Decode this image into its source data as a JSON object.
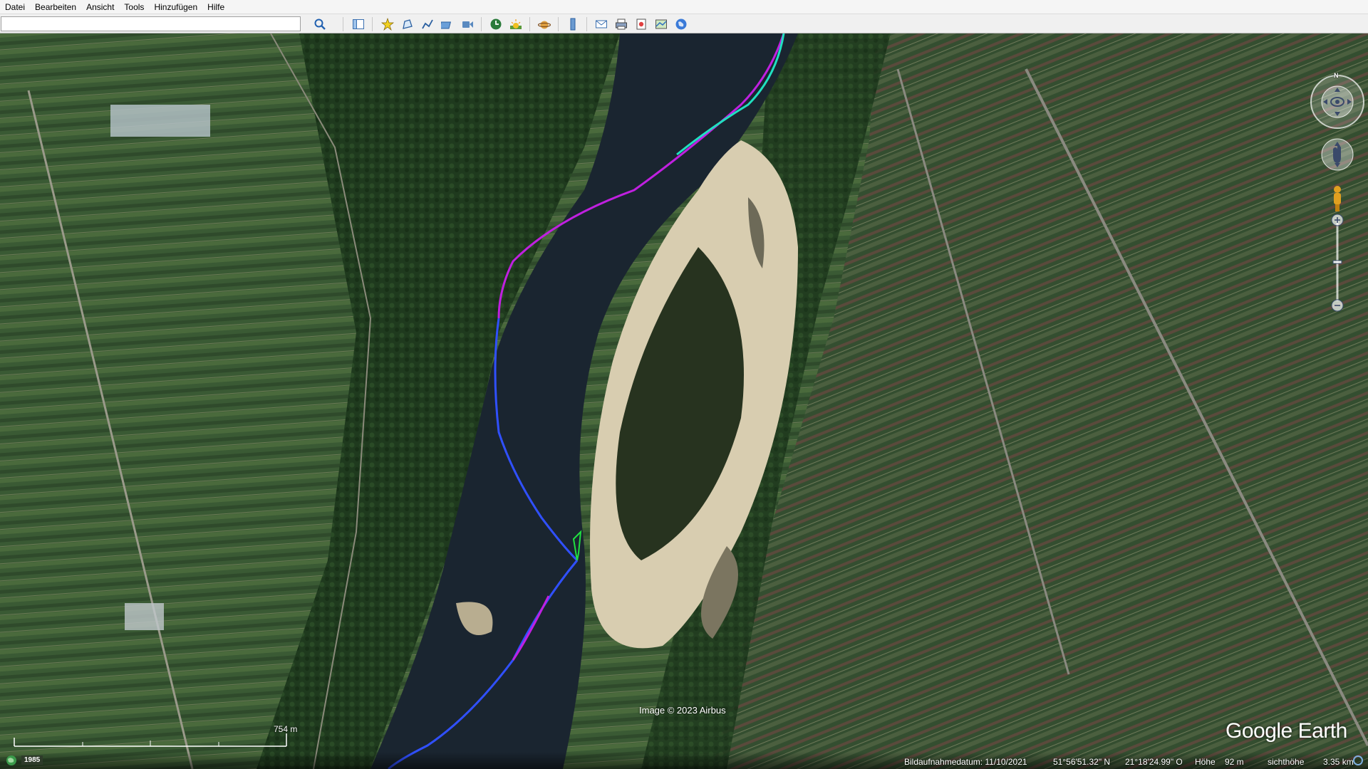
{
  "menu": {
    "items": [
      "Datei",
      "Bearbeiten",
      "Ansicht",
      "Tools",
      "Hinzufügen",
      "Hilfe"
    ]
  },
  "toolbar": {
    "search_value": "",
    "icons": [
      "search-icon",
      "sidebar-toggle-icon",
      "add-placemark-icon",
      "add-polygon-icon",
      "add-path-icon",
      "add-overlay-icon",
      "record-tour-icon",
      "historical-imagery-icon",
      "sunlight-icon",
      "switch-to-sky-icon",
      "ruler-icon",
      "email-icon",
      "print-icon",
      "save-image-icon",
      "view-in-maps-icon",
      "google-earth-icon"
    ]
  },
  "map": {
    "attribution": "Image © 2023 Airbus",
    "logo": "Google Earth",
    "scale_label": "754  m",
    "history_year": "1985"
  },
  "status": {
    "date_label": "Bildaufnahmedatum: 11/10/2021",
    "latitude": "51°56'51.32\" N",
    "longitude": "21°18'24.99\" O",
    "elevation_label": "Höhe",
    "elevation_value": "92 m",
    "eye_alt_label": "sichthöhe",
    "eye_alt_value": "3.35 km"
  },
  "colors": {
    "water": "#1a2530",
    "sand": "#d8cdb0",
    "field_dark": "#2e4a2c",
    "forest": "#1f3a1e",
    "track_magenta": "#c020e0",
    "track_blue": "#3050ff",
    "track_cyan": "#20e0c0"
  },
  "nav": {
    "north_label": "N"
  }
}
